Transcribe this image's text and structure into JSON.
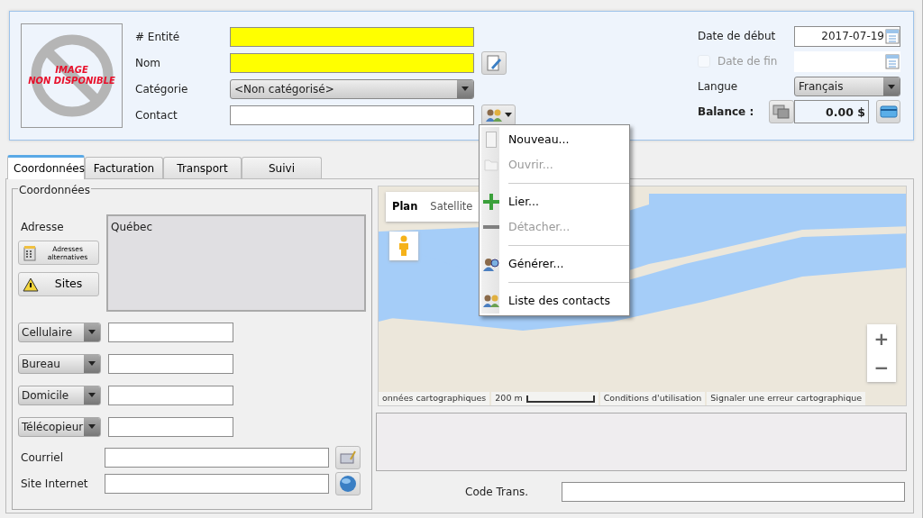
{
  "header": {
    "placeholder_image": {
      "lines": [
        "IMAGE",
        "NON DISPONIBLE"
      ]
    },
    "fields": [
      {
        "label": "# Entité",
        "kind": "text",
        "required": true
      },
      {
        "label": "Nom",
        "kind": "text",
        "required": true,
        "edit_button": true
      },
      {
        "label": "Catégorie",
        "kind": "select",
        "value": "<Non catégorisé>"
      },
      {
        "label": "Contact",
        "kind": "text",
        "required": false,
        "contact_button": true
      }
    ],
    "right_fields": [
      {
        "label": "Date de début",
        "kind": "date",
        "value": "2017-07-19",
        "disabled": false
      },
      {
        "label": "Date de fin",
        "kind": "date",
        "disabled": true,
        "checked": false
      },
      {
        "label": "Langue",
        "kind": "select",
        "value": "Français"
      },
      {
        "label": "Balance :",
        "kind": "balance",
        "value": "0.00 $"
      }
    ]
  },
  "tabs": [
    {
      "label": "Coordonnées",
      "selected": true
    },
    {
      "label": "Facturation",
      "selected": false
    },
    {
      "label": "Transport",
      "selected": false
    },
    {
      "label": "Suivi",
      "selected": false
    }
  ],
  "coordonnees": {
    "legend": "Coordonnées",
    "address_label": "Adresse",
    "address": "Québec",
    "address_buttons": [
      {
        "label": "Adresses alternatives",
        "kind": "alt"
      },
      {
        "label": "Sites",
        "kind": "sites"
      }
    ],
    "phones": [
      {
        "type": "Cellulaire"
      },
      {
        "type": "Bureau"
      },
      {
        "type": "Domicile"
      },
      {
        "type": "Télécopieur"
      }
    ],
    "web_fields": [
      {
        "label": "Courriel",
        "kind": "email"
      },
      {
        "label": "Site Internet",
        "kind": "web"
      }
    ]
  },
  "map": {
    "map_types": [
      {
        "label": "Plan",
        "selected": true
      },
      {
        "label": "Satellite",
        "selected": false
      }
    ],
    "zoom": [
      "+",
      "−"
    ],
    "attribution": [
      "onnées cartographiques",
      "200 m",
      "Conditions d'utilisation",
      "Signaler une erreur cartographique"
    ]
  },
  "code_trans": {
    "label": "Code Trans."
  },
  "menu": [
    {
      "label": "Nouveau...",
      "kind": "new",
      "disabled": false,
      "separator_before": false
    },
    {
      "label": "Ouvrir...",
      "kind": "open",
      "disabled": true,
      "separator_before": false
    },
    {
      "label": "Lier...",
      "kind": "link",
      "disabled": false,
      "separator_before": true
    },
    {
      "label": "Détacher...",
      "kind": "unlink",
      "disabled": true,
      "separator_before": false
    },
    {
      "label": "Générer...",
      "kind": "generate",
      "disabled": false,
      "separator_before": true
    },
    {
      "label": "Liste des contacts",
      "kind": "list",
      "disabled": false,
      "separator_before": true
    }
  ]
}
